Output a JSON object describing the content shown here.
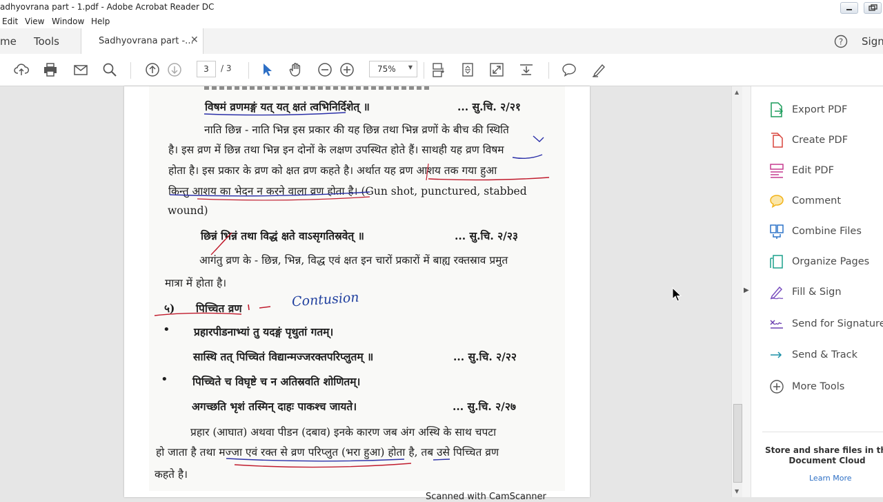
{
  "window": {
    "title": "adhyovrana part - 1.pdf - Adobe Acrobat Reader DC"
  },
  "menu": [
    "Edit",
    "View",
    "Window",
    "Help"
  ],
  "tabs": {
    "home": "me",
    "tools": "Tools",
    "document": "Sadhyovrana part -...",
    "help_icon": "?",
    "sign": "Sign"
  },
  "toolbar": {
    "page_current": "3",
    "page_total": "/ 3",
    "zoom": "75%"
  },
  "document": {
    "lines": [
      "विषमं व्रणमङ्गं यत् यत् क्षतं त्वभिनिर्दिशेत् ॥",
      "... सु.चि. २/२१",
      "नाति छिन्न - नाति भिन्न इस प्रकार की यह छिन्न तथा भिन्न व्रणों के बीच की स्थिति",
      "है। इस व्रण में छिन्न तथा भिन्न इन दोनों के लक्षण उपस्थित होते हैं। साथही यह व्रण विषम",
      "होता है। इस प्रकार के व्रण को क्षत व्रण कहते है। अर्थात यह व्रण आशय तक गया हुआ",
      "किन्तु आशय का भेदन न करने वाला व्रण होता है। (Gun shot, punctured, stabbed",
      "wound)",
      "छिन्नं भिन्नं तथा विद्धं क्षते वाऽसृगतिस्रवेत् ॥",
      "... सु.चि. २/२३",
      "आगंतु व्रण के - छिन्न, भिन्न, विद्ध एवं क्षत इन चारों प्रकारों में बाह्य रक्तस्राव प्रमुत",
      "मात्रा में होता है।",
      "५)",
      "पिच्चित व्रण",
      "Contusion",
      "प्रहारपीडनाभ्यां तु यदङ्गं पृथुतां गतम्।",
      "सास्थि तत् पिच्चितं विद्यान्मज्जरक्तपरिप्लुतम् ॥",
      "... सु.चि. २/२२",
      "पिच्चिते च विघृष्टे च न अतिस्रवति शोणितम्।",
      "अगच्छति भृशं तस्मिन् दाहः पाकश्च जायते।",
      "... सु.चि. २/२७",
      "प्रहार (आघात) अथवा पीडन (दबाव) इनके कारण जब अंग अस्थि के साथ चपटा",
      "हो जाता है तथा मज्जा एवं रक्त से व्रण परिप्लुत (भरा हुआ) होता है, तब उसे पिच्चित व्रण",
      "कहते है।"
    ],
    "footer": "Scanned with CamScanner"
  },
  "right_panel": {
    "tools": [
      {
        "label": "Export PDF",
        "icon": "export-pdf-icon",
        "color": "#1a9c5a"
      },
      {
        "label": "Create PDF",
        "icon": "create-pdf-icon",
        "color": "#d9453d"
      },
      {
        "label": "Edit PDF",
        "icon": "edit-pdf-icon",
        "color": "#c63a8f"
      },
      {
        "label": "Comment",
        "icon": "comment-icon",
        "color": "#f2b319"
      },
      {
        "label": "Combine Files",
        "icon": "combine-files-icon",
        "color": "#2d74c8"
      },
      {
        "label": "Organize Pages",
        "icon": "organize-pages-icon",
        "color": "#1aa08c"
      },
      {
        "label": "Fill & Sign",
        "icon": "fill-sign-icon",
        "color": "#7a4fbf"
      },
      {
        "label": "Send for Signature",
        "icon": "send-signature-icon",
        "color": "#6b3fb0"
      },
      {
        "label": "Send & Track",
        "icon": "send-track-icon",
        "color": "#1a8fa6"
      },
      {
        "label": "More Tools",
        "icon": "more-tools-icon",
        "color": "#555555"
      }
    ],
    "store_text_1": "Store and share files in the",
    "store_text_2": "Document Cloud",
    "learn_more": "Learn More"
  }
}
